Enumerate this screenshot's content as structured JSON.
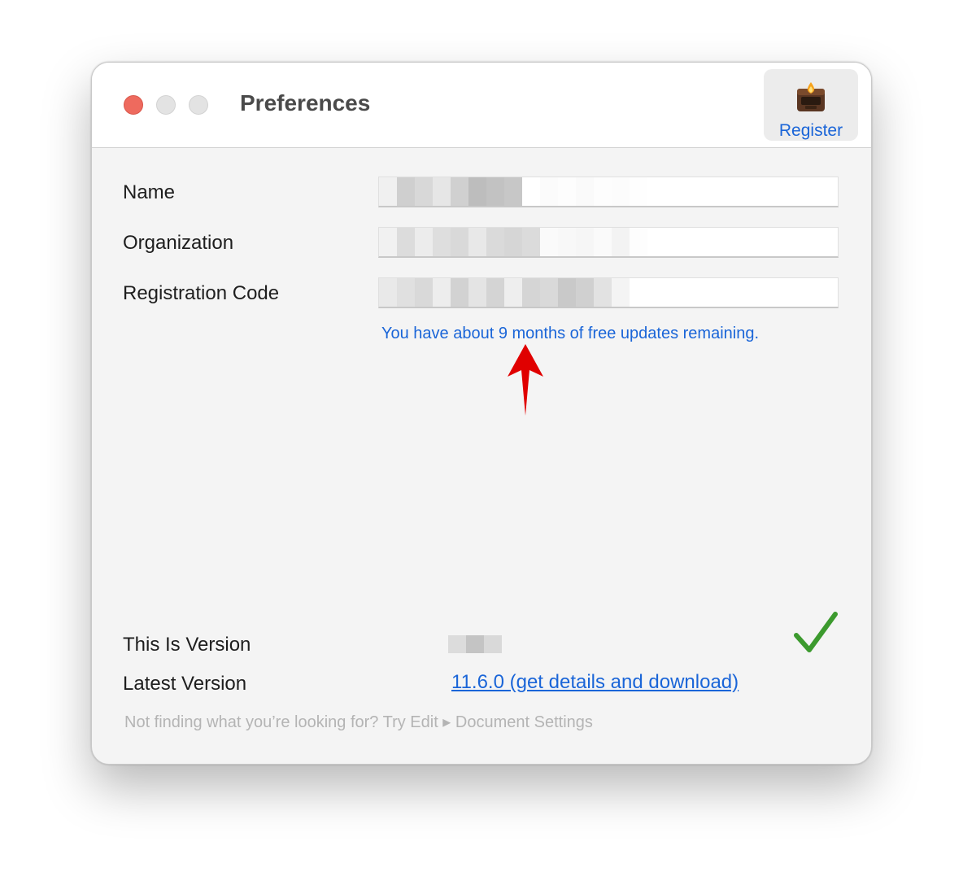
{
  "window": {
    "title": "Preferences"
  },
  "toolbar": {
    "register_label": "Register",
    "register_icon": "register-app-icon"
  },
  "form": {
    "name_label": "Name",
    "organization_label": "Organization",
    "registration_code_label": "Registration Code",
    "name_value": "",
    "organization_value": "",
    "registration_code_value": ""
  },
  "notice": {
    "free_updates_text": "You have about 9 months of free updates remaining."
  },
  "version": {
    "this_is_version_label": "This Is Version",
    "this_is_version_value": "",
    "latest_version_label": "Latest Version",
    "latest_version_link": "11.6.0 (get details and download)",
    "status_icon": "checkmark-icon"
  },
  "hint": {
    "text": "Not finding what you’re looking for? Try Edit ▸ Document Settings"
  },
  "colors": {
    "accent": "#1a65d8",
    "close_button": "#ee6a5e",
    "arrow": "#e00000",
    "checkmark": "#3c9a2e"
  }
}
